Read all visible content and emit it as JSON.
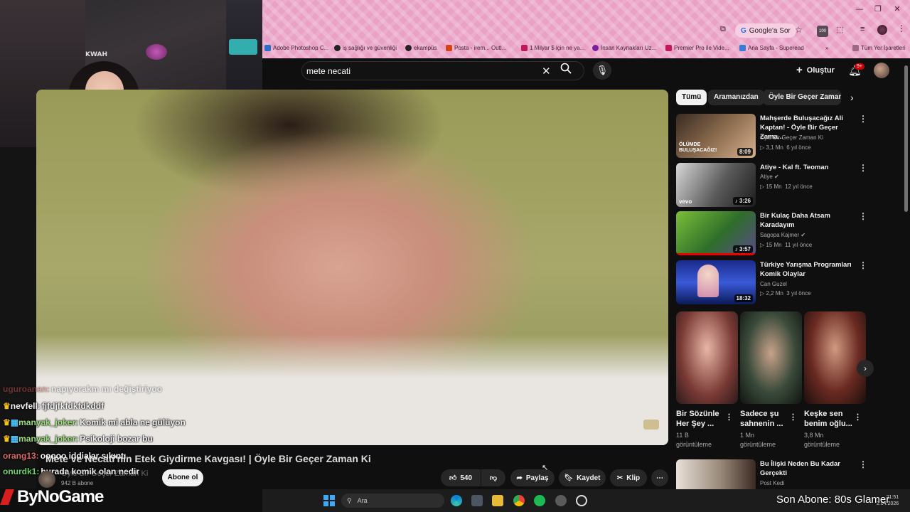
{
  "browser": {
    "google_sor": "Google'a Sor",
    "ext_badge": "100",
    "bookmarks": [
      {
        "label": "Adobe Photoshop C...",
        "color": "#2a70c8"
      },
      {
        "label": "iş sağlığı ve güvenliği",
        "color": "#222222"
      },
      {
        "label": "ekampüs",
        "color": "#222222"
      },
      {
        "label": "Posta - irem... Outl...",
        "color": "#d84315"
      },
      {
        "label": "1 Milyar $ için ne ya...",
        "color": "#c2185b"
      },
      {
        "label": "İnsan Kaynakları Uz...",
        "color": "#7b1fa2"
      },
      {
        "label": "Premier Pro ile Vide...",
        "color": "#c2185b"
      },
      {
        "label": "Ana Sayfa - Superead",
        "color": "#3a7bd5"
      }
    ],
    "all_bookmarks": "Tüm Yer İşaretleri"
  },
  "header": {
    "search_value": "mete necati",
    "create_label": "Oluştur",
    "notif_badge": "9+"
  },
  "video": {
    "title": "Mete ve Necati'nin Etek Giydirme Kavgası! | Öyle Bir Geçer Zaman Ki",
    "channel": "Öyle Bir Geçer Zaman Ki",
    "subscribers": "942 B abone",
    "subscribe_label": "Abone ol",
    "likes": "540",
    "share_label": "Paylaş",
    "save_label": "Kaydet",
    "clip_label": "Klip"
  },
  "chat": [
    {
      "user": "uguroanan:",
      "msg": "napıyorakm mı değiştiriyoo",
      "color": "#d65a5a"
    },
    {
      "user": "nevfell:",
      "msg": "fjfdjfkfdkfdkddf",
      "color": "#f0f0f0"
    },
    {
      "user": "manyak_joker:",
      "msg": "Komik mi abla ne gülüyon",
      "color": "#9be07a"
    },
    {
      "user": "manyak_joker:",
      "msg": "Psikoloji bozar bu",
      "color": "#9be07a"
    },
    {
      "user": "orang13:",
      "msg": "ooooo iddialar sıkıntı",
      "color": "#e06666"
    },
    {
      "user": "onurdk1:",
      "msg": "burada komik olan nedir",
      "color": "#6cd46c"
    }
  ],
  "sidebar": {
    "chips": [
      "Tümü",
      "Aramanızdan",
      "Öyle Bir Geçer Zaman Ki"
    ],
    "recommendations": [
      {
        "title": "Mahşerde Buluşacağız Ali Kaptan! - Öyle Bir Geçer Zama...",
        "channel": "Öyle Bir Geçer Zaman Ki",
        "views": "3,1 Mn",
        "age": "6 yıl önce",
        "duration": "8:09",
        "thumb_text": "ÖLÜMDE BULUŞACAĞIZ!"
      },
      {
        "title": "Atiye - Kal ft. Teoman",
        "channel": "Atiye",
        "views": "15 Mn",
        "age": "12 yıl önce",
        "duration": "3:26",
        "thumb_text": "vevo"
      },
      {
        "title": "Bir Kulaç Daha Atsam Karadayım",
        "channel": "Sagopa Kajmer",
        "views": "15 Mn",
        "age": "11 yıl önce",
        "duration": "3:57",
        "thumb_text": ""
      },
      {
        "title": "Türkiye Yarışma Programları Komik Olaylar",
        "channel": "Can Guzel",
        "views": "2,2 Mn",
        "age": "3 yıl önce",
        "duration": "18:32",
        "thumb_text": ""
      }
    ],
    "shorts": [
      {
        "title": "Bir Sözünle Her Şey ...",
        "views": "11 B",
        "suffix": "görüntüleme"
      },
      {
        "title": "Sadece şu sahnenin ...",
        "views": "1 Mn",
        "suffix": "görüntüleme"
      },
      {
        "title": "Keşke sen benim oğlu...",
        "views": "3,8 Mn",
        "suffix": "görüntüleme"
      }
    ],
    "last": {
      "title": "Bu İlişki Neden Bu Kadar Gerçekti",
      "channel": "Post Kedi"
    }
  },
  "overlay": {
    "brand": "ByNoGame",
    "goal": "Son Abone: 80s Glamer",
    "cam_sign": "KWAH"
  },
  "taskbar": {
    "search": "Ara",
    "time": "21:51",
    "date": "2.04.2026"
  }
}
